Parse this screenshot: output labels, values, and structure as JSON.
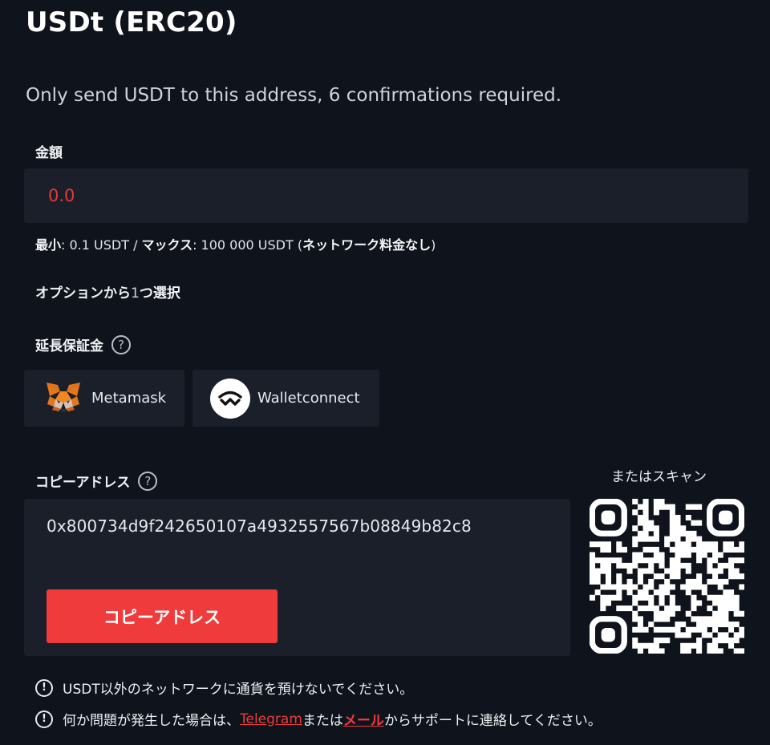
{
  "header": {
    "title": "USDt (ERC20)"
  },
  "notice": "Only send USDT to this address, 6 confirmations required.",
  "amount": {
    "label": "金額",
    "value": "0.0",
    "limits": {
      "min_label": "最小",
      "min_value": ": 0.1 USDT / ",
      "max_label": "マックス",
      "max_value": ": 100 000 USDT (",
      "fee_note": "ネットワーク料金なし",
      "close": ")"
    }
  },
  "options": {
    "prefix": "オプションから",
    "count": "1",
    "suffix": "つ選択"
  },
  "deposit": {
    "label": "延長保証金",
    "help": "?",
    "wallets": [
      {
        "name": "Metamask",
        "icon": "metamask-fox-icon"
      },
      {
        "name": "Walletconnect",
        "icon": "walletconnect-icon"
      }
    ]
  },
  "address": {
    "label": "コピーアドレス",
    "help": "?",
    "value": "0x800734d9f242650107a4932557567b08849b82c8",
    "copy_button": "コピーアドレス"
  },
  "scan": {
    "label": "またはスキャン",
    "icon": "qr-code-icon"
  },
  "notes": {
    "warn_icon": "!",
    "network_warning": "USDT以外のネットワークに通貨を預けないでください。",
    "support_prefix": "何か問題が発生した場合は、",
    "telegram_link": "Telegram",
    "support_mid": "または",
    "mail_link": "メール",
    "support_suffix": "からサポートに連絡してください。"
  },
  "colors": {
    "background": "#0f131b",
    "panel": "#1b1f29",
    "accent": "#ef3b3b",
    "text": "#e9ecf1"
  }
}
